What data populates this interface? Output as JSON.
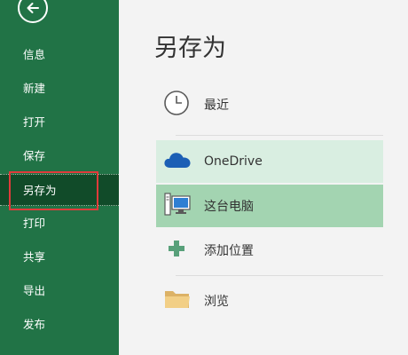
{
  "nav": {
    "back_icon": "back-arrow-icon",
    "items": [
      {
        "label": "信息"
      },
      {
        "label": "新建"
      },
      {
        "label": "打开"
      },
      {
        "label": "保存"
      },
      {
        "label": "另存为",
        "active": true
      },
      {
        "label": "打印"
      },
      {
        "label": "共享"
      },
      {
        "label": "导出"
      },
      {
        "label": "发布"
      }
    ]
  },
  "main": {
    "title": "另存为",
    "locations": [
      {
        "label": "最近",
        "icon": "clock-icon"
      },
      {
        "label": "OneDrive",
        "icon": "cloud-icon"
      },
      {
        "label": "这台电脑",
        "icon": "computer-icon",
        "selected": true
      },
      {
        "label": "添加位置",
        "icon": "plus-icon"
      },
      {
        "label": "浏览",
        "icon": "folder-icon"
      }
    ]
  },
  "colors": {
    "nav_bg": "#217346",
    "nav_active": "#114b29",
    "highlight_border": "#e03b3b",
    "selected_bg": "#a3d4b1",
    "hover_bg": "#d9eee1"
  }
}
